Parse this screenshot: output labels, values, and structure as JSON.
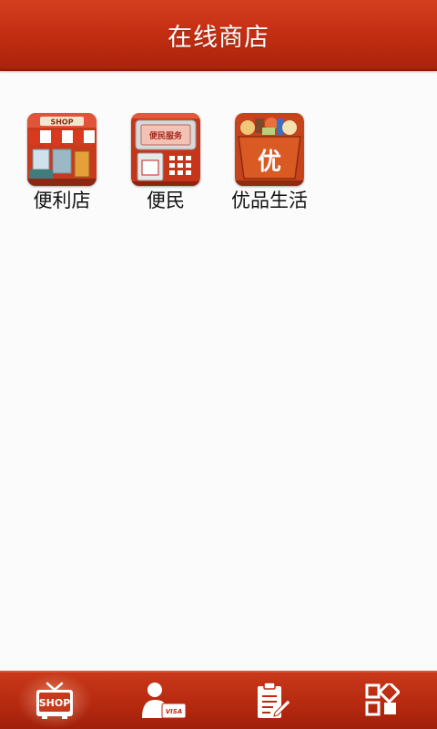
{
  "header": {
    "title": "在线商店"
  },
  "apps": [
    {
      "label": "便利店",
      "icon": "shop-icon",
      "icon_text": "SHOP"
    },
    {
      "label": "便民",
      "icon": "atm-service-icon",
      "icon_text": "便民服务"
    },
    {
      "label": "优品生活",
      "icon": "youpin-basket-icon",
      "icon_text": "优"
    }
  ],
  "tabbar": {
    "tabs": [
      {
        "name": "shop-tv-icon",
        "icon_text": "SHOP",
        "active": true
      },
      {
        "name": "user-card-icon",
        "icon_text": "VISA",
        "active": false
      },
      {
        "name": "notepad-edit-icon",
        "active": false
      },
      {
        "name": "grid-apps-icon",
        "active": false
      }
    ]
  },
  "colors": {
    "brand_red": "#c42f13",
    "brand_dark": "#a0200a",
    "label_text": "#111111"
  }
}
